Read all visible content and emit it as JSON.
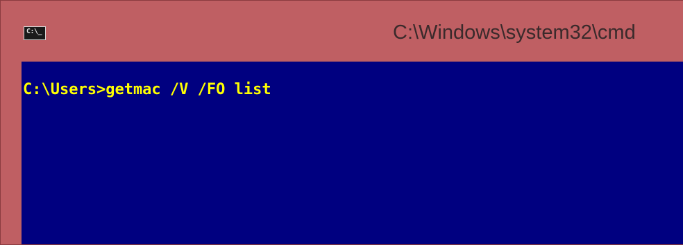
{
  "window": {
    "icon_label": "C:\\_",
    "title": "C:\\Windows\\system32\\cmd"
  },
  "console": {
    "lines": [
      "C:\\Users>getmac /V /FO list"
    ]
  },
  "colors": {
    "titlebar": "#bf5f63",
    "console_background": "#000080",
    "console_text": "#ffff00"
  }
}
